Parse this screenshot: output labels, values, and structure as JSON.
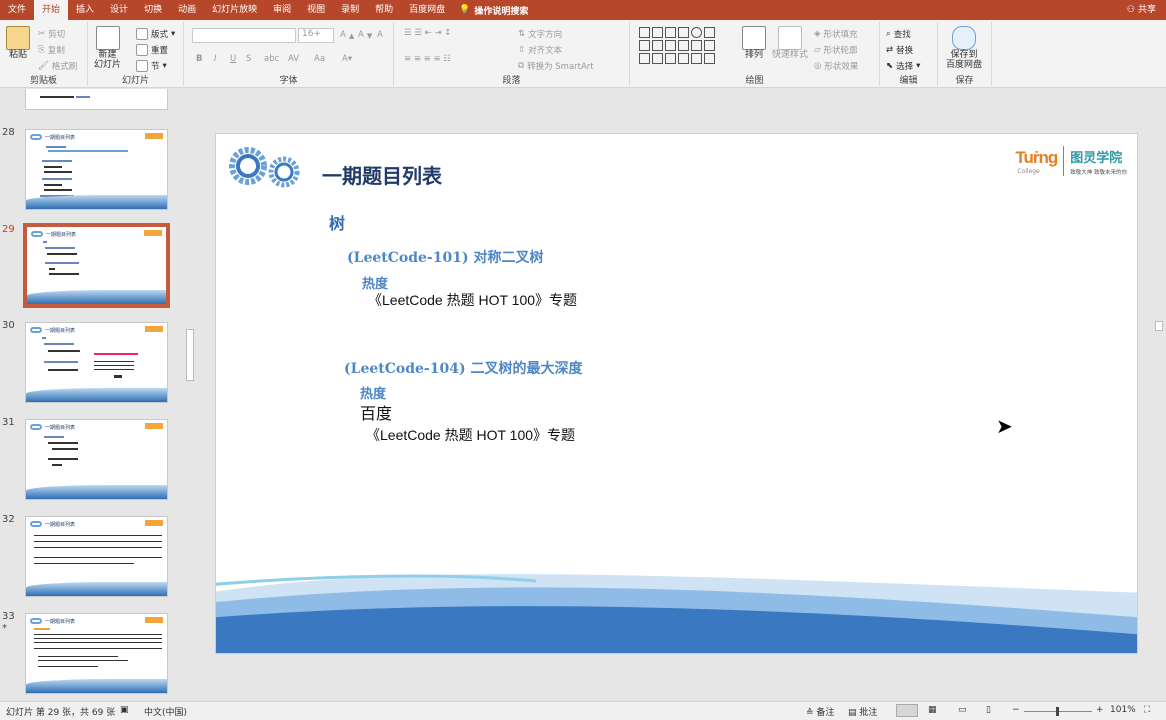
{
  "menu": {
    "tabs": [
      "文件",
      "开始",
      "插入",
      "设计",
      "切换",
      "动画",
      "幻灯片放映",
      "审阅",
      "视图",
      "录制",
      "帮助",
      "百度网盘"
    ],
    "active_tab": "开始",
    "search_label": "操作说明搜索",
    "share_label": "共享"
  },
  "ribbon": {
    "clipboard": {
      "paste": "粘贴",
      "cut": "剪切",
      "copy": "复制",
      "format_painter": "格式刷",
      "label": "剪贴板"
    },
    "slides": {
      "new_slide_line1": "新建",
      "new_slide_line2": "幻灯片",
      "layout": "版式",
      "reset": "重置",
      "section": "节",
      "label": "幻灯片"
    },
    "font": {
      "size": "16+",
      "label": "字体",
      "bold": "B",
      "italic": "I",
      "underline": "U",
      "strike": "S",
      "spacing": "AV",
      "case": "Aa"
    },
    "paragraph": {
      "text_direction": "文字方向",
      "align_text": "对齐文本",
      "smartart": "转换为 SmartArt",
      "label": "段落"
    },
    "drawing": {
      "arrange": "排列",
      "quick_styles": "快速样式",
      "fill": "形状填充",
      "outline": "形状轮廓",
      "effects": "形状效果",
      "label": "绘图"
    },
    "editing": {
      "find": "查找",
      "replace": "替换",
      "select": "选择",
      "label": "编辑"
    },
    "save": {
      "line1": "保存到",
      "line2": "百度网盘",
      "label": "保存"
    }
  },
  "thumbnails": [
    {
      "num": "",
      "title": ""
    },
    {
      "num": "28",
      "title": "一期题目列表"
    },
    {
      "num": "29",
      "title": "一期题目列表"
    },
    {
      "num": "30",
      "title": "一期题目列表"
    },
    {
      "num": "31",
      "title": "一期题目列表"
    },
    {
      "num": "32",
      "title": "一期题目列表"
    },
    {
      "num": "33",
      "title": "一期题目列表"
    }
  ],
  "selected_slide": "29",
  "slide": {
    "title": "一期题目列表",
    "section": "树",
    "item1": {
      "code": "(LeetCode-101)",
      "name": "对称二叉树",
      "hot_label": "热度",
      "line": "《LeetCode 热题 HOT 100》专题"
    },
    "item2": {
      "code": "(LeetCode-104)",
      "name": "二叉树的最大深度",
      "hot_label": "热度",
      "line1": "百度",
      "line2": "《LeetCode 热题 HOT 100》专题"
    },
    "brand": {
      "word": "Tuṙng",
      "college": "College",
      "cn": "图灵学院",
      "slogan": "致敬大神 致敬未来的你"
    }
  },
  "statusbar": {
    "slide_info": "幻灯片 第 29 张，共 69 张",
    "language": "中文(中国)",
    "notes": "备注",
    "comments": "批注",
    "zoom": "101%"
  },
  "colors": {
    "accent": "#b7472a",
    "title": "#1f3b66",
    "link_blue": "#4f86c6",
    "selection": "#c55a3c"
  }
}
